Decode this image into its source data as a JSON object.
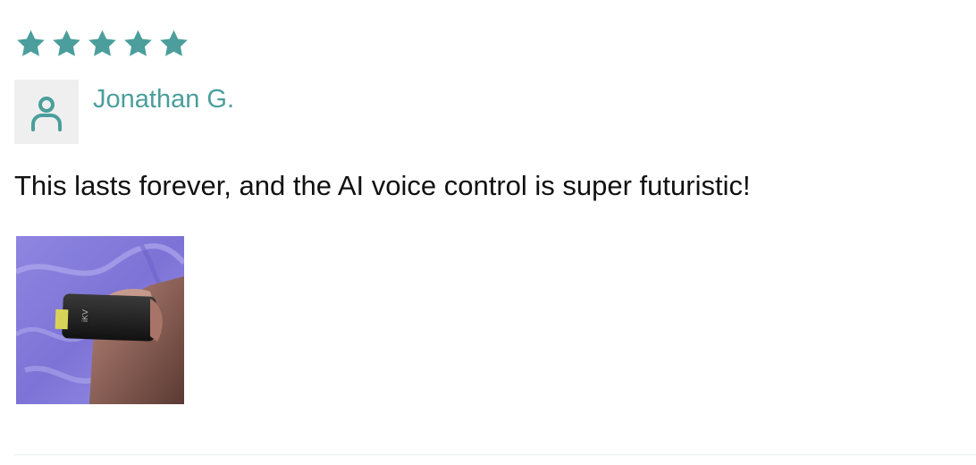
{
  "review": {
    "rating": 5,
    "rating_max": 5,
    "author": "Jonathan G.",
    "text": "This lasts forever, and the AI voice control is super futuristic!",
    "photo_alt": "Photo of the product held in hand"
  },
  "theme": {
    "accent": "#4b9e9c",
    "avatar_bg": "#efefef",
    "text_color": "#111111"
  },
  "icons": {
    "star": "star-icon",
    "avatar": "user-icon"
  }
}
